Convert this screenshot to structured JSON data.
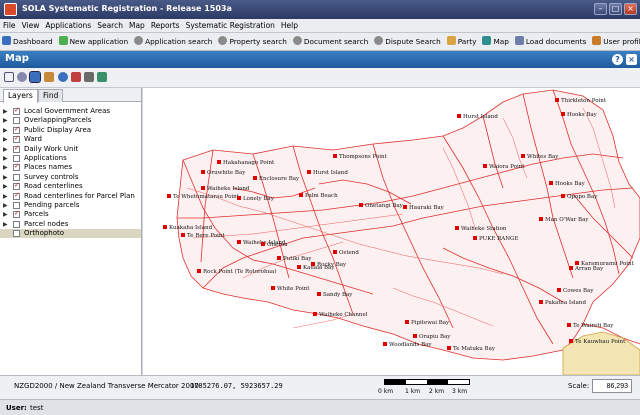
{
  "window": {
    "title": "SOLA Systematic Registration - Release 1503a"
  },
  "menu": [
    "File",
    "View",
    "Applications",
    "Search",
    "Map",
    "Reports",
    "Systematic Registration",
    "Help"
  ],
  "toolbar": [
    {
      "label": "Dashboard",
      "icon": "dashboard-icon"
    },
    {
      "label": "New application",
      "icon": "new-application-icon"
    },
    {
      "label": "Application search",
      "icon": "search-icon"
    },
    {
      "label": "Property search",
      "icon": "search-icon"
    },
    {
      "label": "Document search",
      "icon": "search-icon"
    },
    {
      "label": "Dispute Search",
      "icon": "search-icon"
    },
    {
      "label": "Party",
      "icon": "party-icon"
    },
    {
      "label": "Map",
      "icon": "map-icon"
    },
    {
      "label": "Load documents",
      "icon": "load-documents-icon"
    },
    {
      "label": "User profile",
      "icon": "user-icon"
    }
  ],
  "panel": {
    "title": "Map",
    "help": "?",
    "close": "×"
  },
  "tabs": [
    "Layers",
    "Find"
  ],
  "layers": [
    {
      "label": "Local Government Areas",
      "checked": true,
      "expand": true
    },
    {
      "label": "OverlappingParcels",
      "checked": false,
      "expand": true
    },
    {
      "label": "Public Display Area",
      "checked": true,
      "expand": true
    },
    {
      "label": "Ward",
      "checked": true,
      "expand": true
    },
    {
      "label": "Daily Work Unit",
      "checked": true,
      "expand": true
    },
    {
      "label": "Applications",
      "checked": false,
      "expand": true
    },
    {
      "label": "Places names",
      "checked": true,
      "expand": true
    },
    {
      "label": "Survey controls",
      "checked": false,
      "expand": true
    },
    {
      "label": "Road centerlines",
      "checked": true,
      "expand": true
    },
    {
      "label": "Road centerlines for Parcel Plan",
      "checked": true,
      "expand": true
    },
    {
      "label": "Pending parcels",
      "checked": false,
      "expand": true
    },
    {
      "label": "Parcels",
      "checked": true,
      "expand": true
    },
    {
      "label": "Parcel nodes",
      "checked": false,
      "expand": true
    },
    {
      "label": "Orthophoto",
      "checked": false,
      "expand": false,
      "selected": true
    }
  ],
  "places": [
    {
      "name": "Thirkleton Point"
    },
    {
      "name": "Hooks Bay"
    },
    {
      "name": "Thompsons Point"
    },
    {
      "name": "Hakahanago Point"
    },
    {
      "name": "Oruwhite Bay"
    },
    {
      "name": "Waiheke Island"
    },
    {
      "name": "Enclosure Bay"
    },
    {
      "name": "Hurst Island"
    },
    {
      "name": "Te Whetumatarau Point"
    },
    {
      "name": "Lonely Bay"
    },
    {
      "name": "Palm Beach"
    },
    {
      "name": "Onetangi Bay"
    },
    {
      "name": "Hauraki Bay"
    },
    {
      "name": "Man O'War Bay"
    },
    {
      "name": "Waiheke Station"
    },
    {
      "name": "PUKE RANGE"
    },
    {
      "name": "Waiheke Island"
    },
    {
      "name": "Ostend"
    },
    {
      "name": "Rocky Bay"
    },
    {
      "name": "Te Rere Point"
    },
    {
      "name": "Kuakaha Island"
    },
    {
      "name": "Rock Point (Te Rotorohua)"
    },
    {
      "name": "Oneroa"
    },
    {
      "name": "White Point"
    },
    {
      "name": "Putiki Bay"
    },
    {
      "name": "Kauaia Bay"
    },
    {
      "name": "Sandy Bay"
    },
    {
      "name": "Waiheke Channel"
    },
    {
      "name": "Opopo Bay"
    },
    {
      "name": "Waiora Point"
    },
    {
      "name": "Hooks Bay"
    },
    {
      "name": "Hurst Island"
    },
    {
      "name": "Woodlands Bay"
    },
    {
      "name": "Pipitewai Bay"
    },
    {
      "name": "Te Matuku Bay"
    },
    {
      "name": "Orapiu Bay"
    },
    {
      "name": "Cowes Bay"
    },
    {
      "name": "Karamuramu Point"
    },
    {
      "name": "Te Kauwhau Point"
    },
    {
      "name": "Te Waireti Bay"
    },
    {
      "name": "Whites Bay"
    },
    {
      "name": "Arran Bay"
    },
    {
      "name": "Pakatoa Island"
    }
  ],
  "status": {
    "crs": "NZGD2000 / New Zealand Transverse Mercator 2000",
    "coords": "1785276.07, 5923657.29",
    "scale_labels": [
      "0 km",
      "1 km",
      "2 km",
      "3 km"
    ],
    "scale_label": "Scale:",
    "scale_value": "86,293"
  },
  "user": {
    "label": "User:",
    "name": "test"
  },
  "colors": {
    "title_bar": "#2c3a66",
    "panel_header": "#1d5a9c",
    "parcel_lines": "#e03030",
    "place_marker": "#e00000"
  }
}
